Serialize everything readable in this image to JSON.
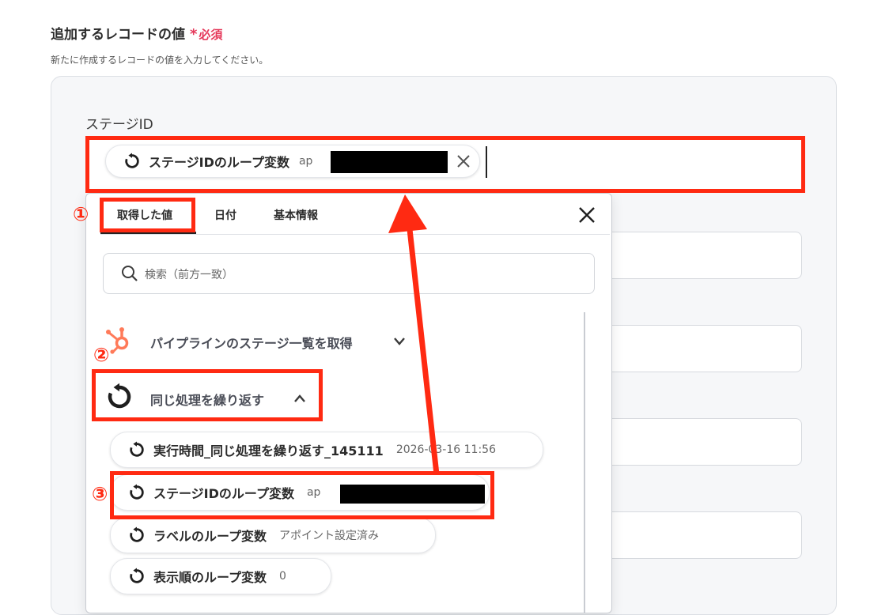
{
  "section": {
    "title": "追加するレコードの値",
    "required_star": "*",
    "required_label": "必須",
    "description": "新たに作成するレコードの値を入力してください。"
  },
  "field": {
    "label": "ステージID",
    "chip_label": "ステージIDのループ変数",
    "chip_value_prefix": "ap"
  },
  "dropdown": {
    "tabs": [
      "取得した値",
      "日付",
      "基本情報"
    ],
    "search_placeholder": "検索（前方一致）",
    "groups": [
      {
        "label": "パイプラインのステージ一覧を取得",
        "icon": "hubspot-icon",
        "expanded": false
      },
      {
        "label": "同じ処理を繰り返す",
        "icon": "loop-icon",
        "expanded": true
      }
    ],
    "items": [
      {
        "label": "実行時間_同じ処理を繰り返す_145111",
        "value": "2026-03-16 11:56"
      },
      {
        "label": "ステージIDのループ変数",
        "value": "ap"
      },
      {
        "label": "ラベルのループ変数",
        "value": "アポイント設定済み"
      },
      {
        "label": "表示順のループ変数",
        "value": "0"
      }
    ]
  },
  "annotations": {
    "step1": "①",
    "step2": "②",
    "step3": "③"
  },
  "colors": {
    "highlight": "#ff2a12",
    "required": "#e5385a",
    "hubspot": "#ff7a59"
  }
}
